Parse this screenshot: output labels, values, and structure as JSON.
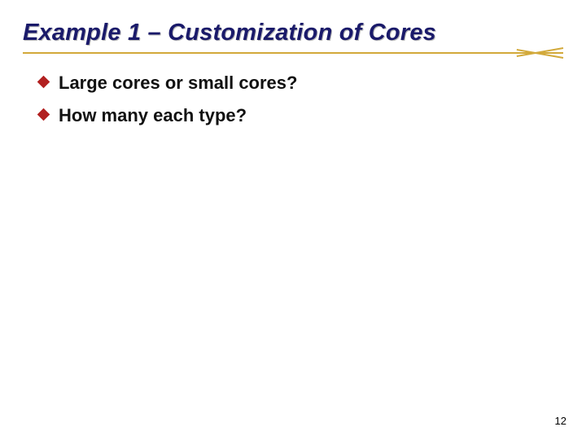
{
  "title": "Example 1 – Customization of Cores",
  "bullets": [
    "Large cores or small cores?",
    "How many each type?"
  ],
  "page_number": "12"
}
